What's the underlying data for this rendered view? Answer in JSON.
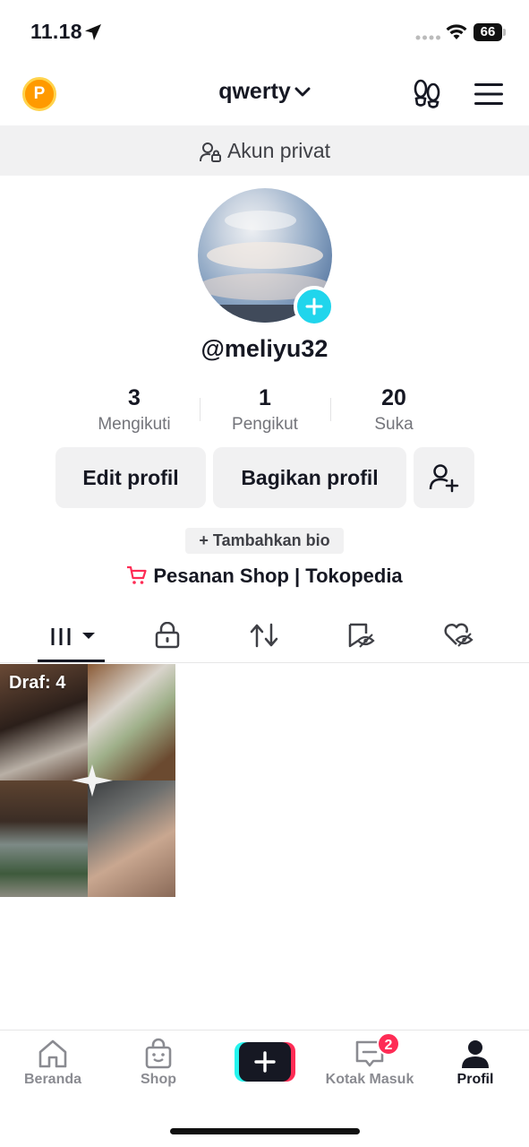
{
  "status_bar": {
    "time": "11.18",
    "battery": "66"
  },
  "header": {
    "username": "qwerty",
    "coin_label": "P"
  },
  "private_banner": {
    "text": "Akun privat"
  },
  "profile": {
    "handle": "@meliyu32"
  },
  "stats": [
    {
      "value": "3",
      "label": "Mengikuti"
    },
    {
      "value": "1",
      "label": "Pengikut"
    },
    {
      "value": "20",
      "label": "Suka"
    }
  ],
  "buttons": {
    "edit": "Edit profil",
    "share": "Bagikan profil"
  },
  "bio": {
    "add_label": "+ Tambahkan bio"
  },
  "shop": {
    "label": "Pesanan Shop | Tokopedia"
  },
  "grid": {
    "draft_label": "Draf: 4"
  },
  "bottom_nav": {
    "items": [
      {
        "label": "Beranda"
      },
      {
        "label": "Shop"
      },
      {
        "label": ""
      },
      {
        "label": "Kotak Masuk"
      },
      {
        "label": "Profil"
      }
    ],
    "inbox_badge": "2"
  },
  "colors": {
    "accent_cyan": "#20d5ec",
    "accent_red": "#fe2c55",
    "coin": "#ff9a00"
  }
}
